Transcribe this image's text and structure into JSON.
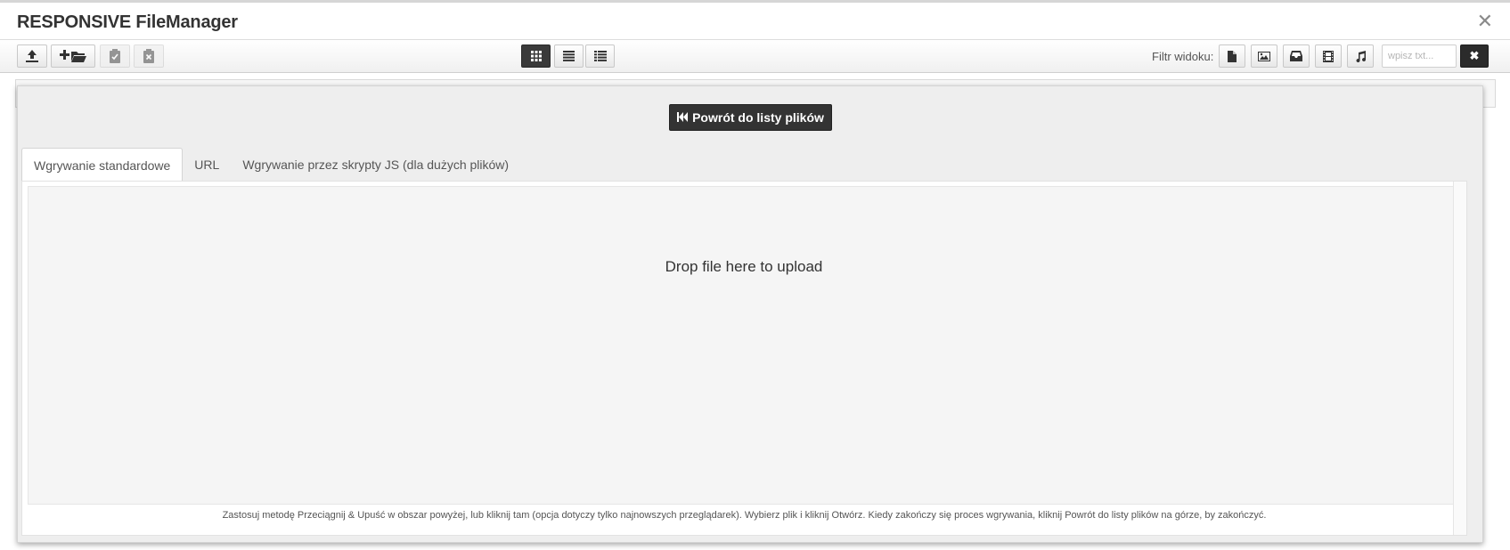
{
  "window": {
    "title": "RESPONSIVE FileManager",
    "close_label": "✕"
  },
  "toolbar": {
    "left_buttons": [
      {
        "icon": "upload-icon"
      },
      {
        "icon": "new-folder-icon"
      },
      {
        "icon": "paste-clipboard-icon",
        "disabled": true
      },
      {
        "icon": "clear-clipboard-icon",
        "disabled": true
      }
    ],
    "view_buttons": [
      {
        "icon": "grid-view-icon",
        "active": true
      },
      {
        "icon": "list-view-icon"
      },
      {
        "icon": "columns-view-icon"
      }
    ],
    "filter_label": "Filtr widoku:",
    "filter_buttons": [
      {
        "icon": "file-icon"
      },
      {
        "icon": "image-icon"
      },
      {
        "icon": "archive-icon"
      },
      {
        "icon": "video-icon"
      },
      {
        "icon": "music-icon"
      }
    ],
    "search_placeholder": "wpisz txt...",
    "search_value": "",
    "clear_label": "✖"
  },
  "upload": {
    "back_button_label": "Powrót do listy plików",
    "tabs": [
      {
        "label": "Wgrywanie standardowe",
        "active": true
      },
      {
        "label": "URL",
        "active": false
      },
      {
        "label": "Wgrywanie przez skrypty JS (dla dużych plików)",
        "active": false
      }
    ],
    "drop_text": "Drop file here to upload",
    "help_text": "Zastosuj metodę Przeciągnij & Upuść w obszar powyżej, lub kliknij tam (opcja dotyczy tylko najnowszych przeglądarek). Wybierz plik i kliknij Otwórz. Kiedy zakończy się proces wgrywania, kliknij Powrót do listy plików na górze, by zakończyć."
  },
  "colors": {
    "dark_button": "#333333",
    "panel_bg": "#eeeeee",
    "dropzone_bg": "#f5f5f5"
  }
}
